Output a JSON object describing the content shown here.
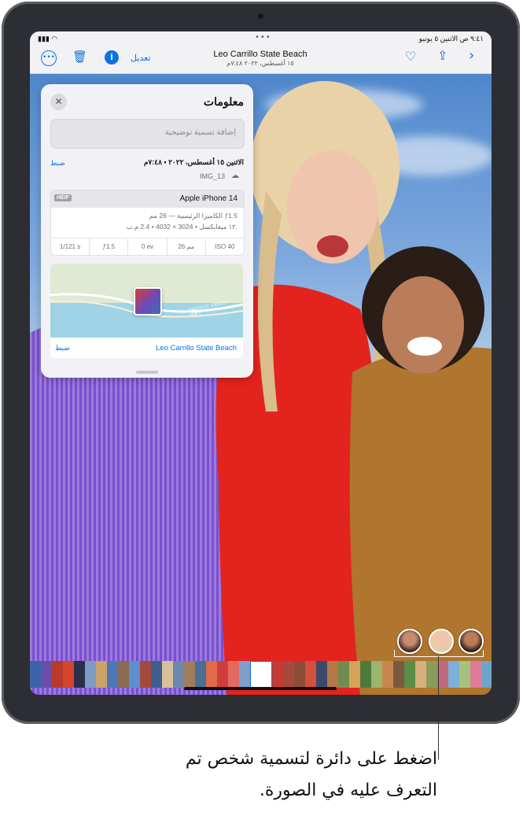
{
  "status_bar": {
    "time_date": "٩:٤١ ص  الاثنين ٥ يونيو",
    "multitask_dots": "•••"
  },
  "nav": {
    "title": "Leo Carrillo State Beach",
    "subtitle": "١٥ أغسطس، ٢٠٢٢ ٧:٤٨م",
    "edit_label": "تعديل",
    "icons": [
      "more-icon",
      "trash-icon",
      "info-icon",
      "heart-icon",
      "share-icon",
      "chevron-right-icon"
    ]
  },
  "info_panel": {
    "title": "معلومات",
    "caption_placeholder": "إضافة تسمية توضيحية",
    "datetime": "الاثنين ١٥ أغسطس، ٢٠٢٢ • ٧:٤٨م",
    "adjust_label": "ضبط",
    "filename": "IMG_13",
    "format_badge": "HEIF",
    "device": "Apple iPhone 14",
    "lens": "الكاميرا الرئيسية — 26 مم ƒ1.5",
    "resolution": "١٢ ميغابكسل • 3024 × 4032 • 2.4 م.ب.",
    "specs": [
      "1/121 s",
      "ƒ1.5",
      "0 ev",
      "26 مم",
      "ISO 40"
    ],
    "map_road_label": "PACIFIC COAST HWY",
    "place": "Leo Carrillo State Beach",
    "place_adjust_label": "ضبط"
  },
  "callout": {
    "text": "اضغط على دائرة لتسمية شخص تم التعرف عليه في الصورة."
  },
  "colors": {
    "accent": "#0a72e8"
  }
}
